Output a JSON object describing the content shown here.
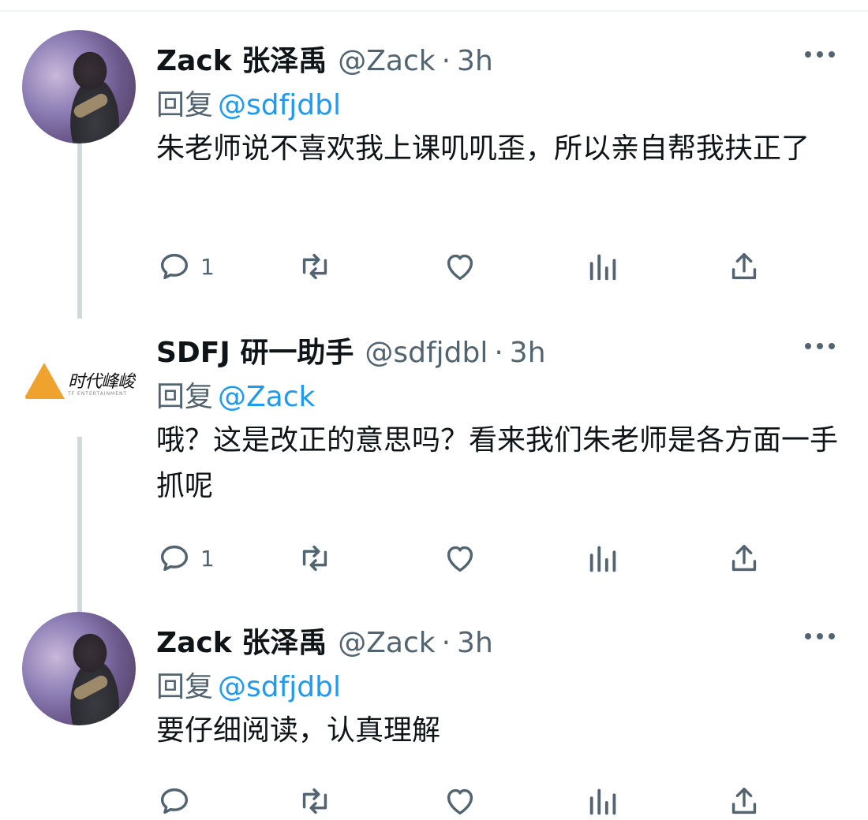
{
  "tweets": [
    {
      "name": "Zack 张泽禹",
      "handle": "@Zack",
      "separator": "·",
      "time": "3h",
      "reply_prefix": "回复",
      "reply_to": "@sdfjdbl",
      "text": "朱老师说不喜欢我上课叽叽歪，所以亲自帮我扶正了",
      "reply_count": "1"
    },
    {
      "name": "SDFJ 研一助手",
      "handle": "@sdfjdbl",
      "separator": "·",
      "time": "3h",
      "reply_prefix": "回复",
      "reply_to": "@Zack",
      "text": "哦？这是改正的意思吗？看来我们朱老师是各方面一手抓呢",
      "reply_count": "1",
      "logo_text": "时代峰峻",
      "logo_subtext": "TF ENTERTAINMENT"
    },
    {
      "name": "Zack 张泽禹",
      "handle": "@Zack",
      "separator": "·",
      "time": "3h",
      "reply_prefix": "回复",
      "reply_to": "@sdfjdbl",
      "text": "要仔细阅读，认真理解"
    }
  ],
  "colors": {
    "text": "#0f1419",
    "secondary": "#536471",
    "mention": "#1d9bf0",
    "thread_line": "#cfd9de",
    "logo_accent": "#f0a22e"
  },
  "icons": [
    "reply-icon",
    "retweet-icon",
    "like-icon",
    "views-icon",
    "share-icon",
    "more-icon"
  ]
}
